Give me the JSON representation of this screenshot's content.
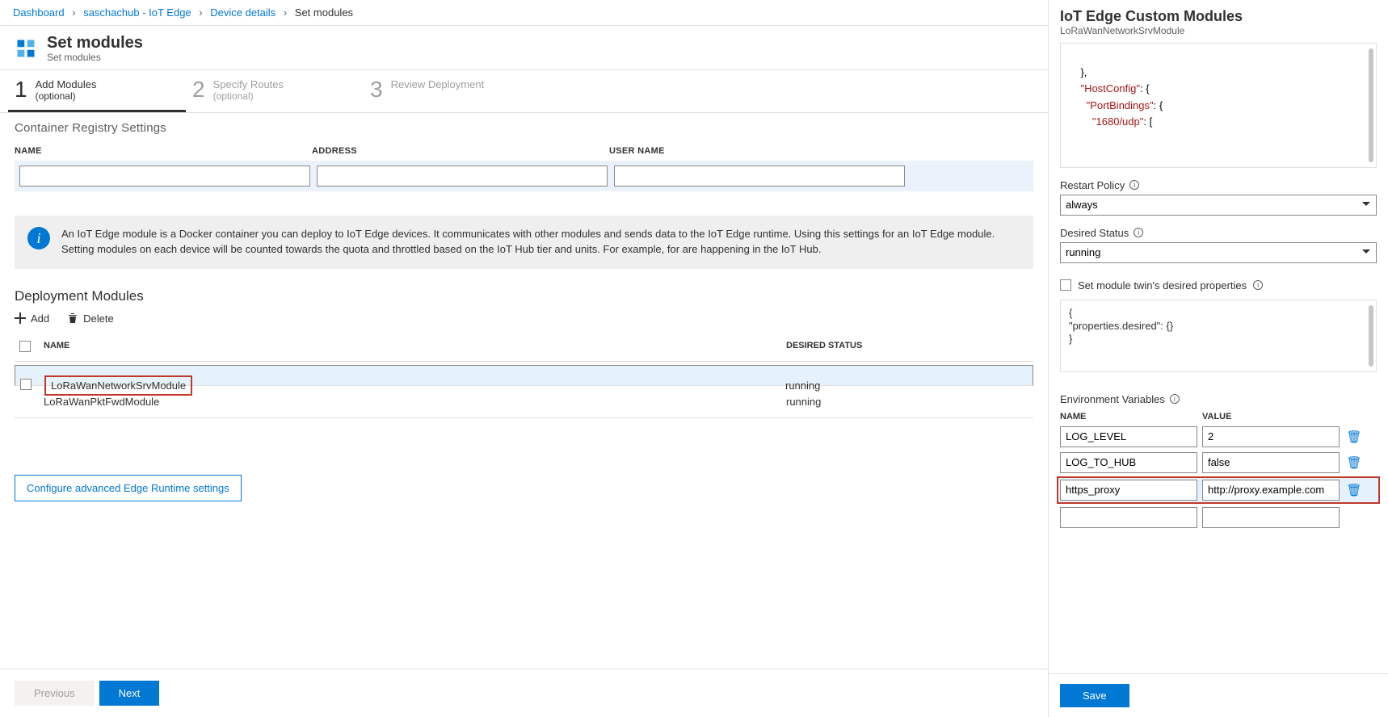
{
  "breadcrumbs": {
    "b0": "Dashboard",
    "b1": "saschachub - IoT Edge",
    "b2": "Device details",
    "b3": "Set modules"
  },
  "page": {
    "title": "Set modules",
    "subtitle": "Set modules"
  },
  "steps": {
    "s1_t": "Add Modules",
    "s1_o": "(optional)",
    "s2_t": "Specify Routes",
    "s2_o": "(optional)",
    "s3_t": "Review Deployment"
  },
  "registry": {
    "section": "Container Registry Settings",
    "h_name": "NAME",
    "h_addr": "ADDRESS",
    "h_user": "USER NAME"
  },
  "info_text": "An IoT Edge module is a Docker container you can deploy to IoT Edge devices. It communicates with other modules and sends data to the IoT Edge runtime. Using this settings for an IoT Edge module. Setting modules on each device will be counted towards the quota and throttled based on the IoT Hub tier and units. For example, for are happening in the IoT Hub.",
  "dm": {
    "title": "Deployment Modules",
    "add": "Add",
    "delete": "Delete",
    "h_name": "NAME",
    "h_status": "DESIRED STATUS",
    "rows": [
      {
        "name": "LoRaWanNetworkSrvModule",
        "status": "running"
      },
      {
        "name": "LoRaWanPktFwdModule",
        "status": "running"
      }
    ]
  },
  "cfg_link": "Configure advanced Edge Runtime settings",
  "nav": {
    "prev": "Previous",
    "next": "Next"
  },
  "panel": {
    "title": "IoT Edge Custom Modules",
    "subtitle": "LoRaWanNetworkSrvModule",
    "code_l1": "},",
    "code_l2": "\"HostConfig\"",
    "code_l3": "\"PortBindings\"",
    "code_l4": "\"1680/udp\"",
    "restart_lbl": "Restart Policy",
    "restart_val": "always",
    "desired_lbl": "Desired Status",
    "desired_val": "running",
    "twin_chk": "Set module twin's desired properties",
    "twin_code_k": "\"properties.desired\"",
    "env_lbl": "Environment Variables",
    "env_h_name": "NAME",
    "env_h_val": "VALUE",
    "env": [
      {
        "name": "LOG_LEVEL",
        "value": "2"
      },
      {
        "name": "LOG_TO_HUB",
        "value": "false"
      },
      {
        "name": "https_proxy",
        "value": "http://proxy.example.com"
      },
      {
        "name": "",
        "value": ""
      }
    ],
    "save": "Save"
  }
}
